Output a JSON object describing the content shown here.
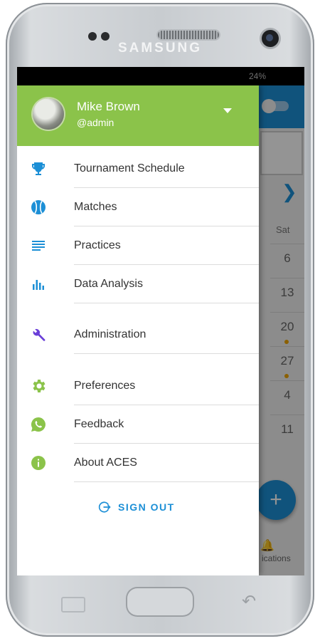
{
  "device": {
    "brand": "SAMSUNG"
  },
  "status_bar": {
    "battery": "24%"
  },
  "background_app": {
    "weekday": "Sat",
    "days": [
      "6",
      "13",
      "20",
      "27",
      "4",
      "11"
    ],
    "days_with_events": [
      "20",
      "27"
    ],
    "fab_label": "+",
    "bottom_nav_label": "ications"
  },
  "drawer": {
    "user": {
      "name": "Mike Brown",
      "handle": "@admin"
    },
    "items": [
      {
        "label": "Tournament Schedule",
        "icon": "trophy-icon",
        "color": "#1c8fd6"
      },
      {
        "label": "Matches",
        "icon": "tennis-ball-icon",
        "color": "#1c8fd6"
      },
      {
        "label": "Practices",
        "icon": "list-icon",
        "color": "#1c8fd6"
      },
      {
        "label": "Data Analysis",
        "icon": "bar-chart-icon",
        "color": "#1c8fd6"
      },
      {
        "label": "Administration",
        "icon": "wrench-icon",
        "color": "#6a3fd8"
      },
      {
        "label": "Preferences",
        "icon": "gear-icon",
        "color": "#8bc34a"
      },
      {
        "label": "Feedback",
        "icon": "whatsapp-icon",
        "color": "#8bc34a"
      },
      {
        "label": "About ACES",
        "icon": "info-icon",
        "color": "#8bc34a"
      }
    ],
    "sign_out_label": "SIGN OUT"
  },
  "colors": {
    "header_green": "#8bc34a",
    "accent_blue": "#1c8fd6"
  }
}
